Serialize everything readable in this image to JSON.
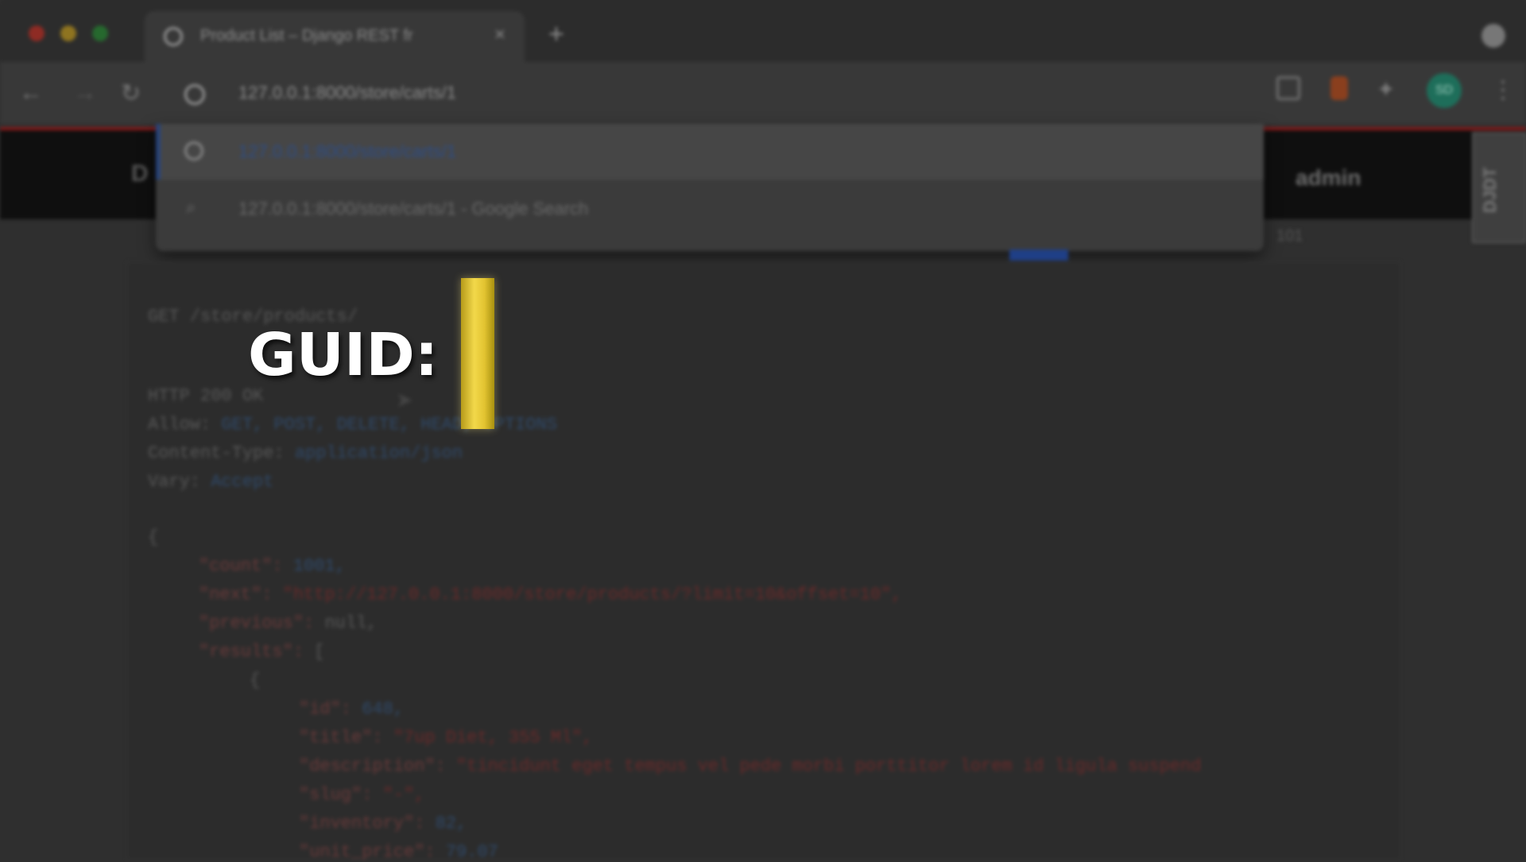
{
  "browser": {
    "tab_title": "Product List – Django REST fr",
    "tab_close": "×",
    "new_tab": "+",
    "address_url": "127.0.0.1:8000/store/carts/1",
    "avatar_initials": "SD",
    "suggestions": [
      {
        "text": "127.0.0.1:8000/store/carts/1"
      },
      {
        "text": "127.0.0.1:8000/store/carts/1 - Google Search"
      }
    ],
    "pagination_fragment": "101"
  },
  "django": {
    "brand": "D",
    "user": "admin",
    "side_tag": "DJDT"
  },
  "response": {
    "request_line": "GET /store/products/",
    "status": "HTTP 200 OK",
    "allow_label": "Allow:",
    "allow_value": "GET, POST, DELETE, HEAD, OPTIONS",
    "content_type_label": "Content-Type:",
    "content_type_value": "application/json",
    "vary_label": "Vary:",
    "vary_value": "Accept",
    "body": {
      "open": "{",
      "count_key": "\"count\":",
      "count_val": "1001,",
      "next_key": "\"next\":",
      "next_val": "\"http://127.0.0.1:8000/store/products/?limit=10&offset=10\",",
      "previous_key": "\"previous\":",
      "previous_val": "null,",
      "results_key": "\"results\":",
      "results_open": "[",
      "obj_open": "{",
      "id_key": "\"id\":",
      "id_val": "648,",
      "title_key": "\"title\":",
      "title_val": "\"7up Diet, 355 Ml\",",
      "description_key": "\"description\":",
      "description_val": "\"tincidunt eget tempus vel pede morbi porttitor lorem id ligula suspend",
      "slug_key": "\"slug\":",
      "slug_val": "\"-\",",
      "inventory_key": "\"inventory\":",
      "inventory_val": "82,",
      "unit_price_key": "\"unit_price\":",
      "unit_price_val": "79.07"
    }
  },
  "overlay": {
    "caption": "GUID: G"
  },
  "colors": {
    "traffic_red": "#c0392b",
    "traffic_yellow": "#c9a227",
    "traffic_green": "#2e8b3a",
    "highlight": "#e8cc3a"
  }
}
